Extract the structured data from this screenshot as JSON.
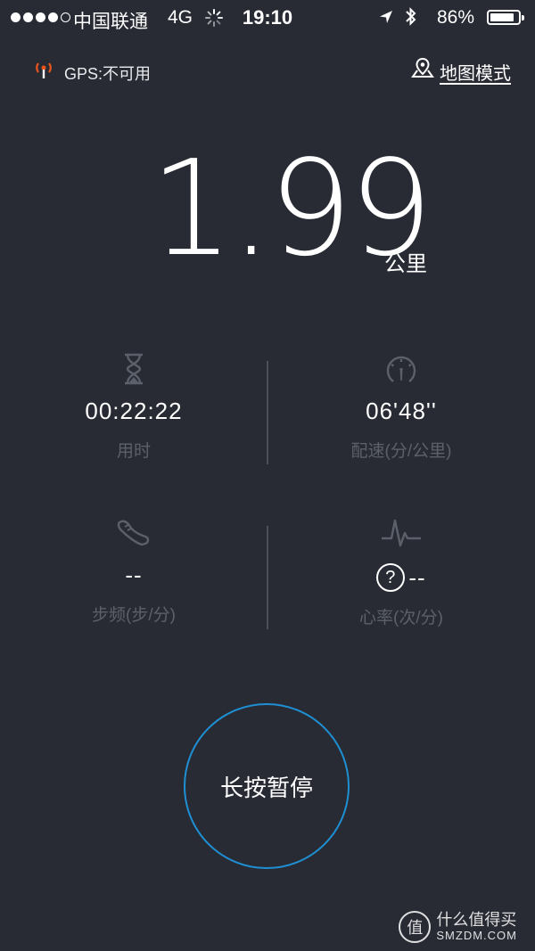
{
  "status_bar": {
    "carrier": "中国联通",
    "network": "4G",
    "time": "19:10",
    "battery": "86%",
    "battery_level": 0.86,
    "signal_bars": 4
  },
  "header": {
    "gps_status": "GPS:不可用",
    "map_mode": "地图模式"
  },
  "distance": {
    "value": "1.99",
    "unit": "公里"
  },
  "stats": {
    "duration": {
      "value": "00:22:22",
      "label": "用时",
      "icon": "hourglass-icon"
    },
    "pace": {
      "value": "06'48''",
      "label": "配速(分/公里)",
      "icon": "speedometer-icon"
    },
    "cadence": {
      "value": "--",
      "label": "步频(步/分)",
      "icon": "shoe-icon"
    },
    "heart_rate": {
      "value": "--",
      "help": "?",
      "label": "心率(次/分)",
      "icon": "heartbeat-icon"
    }
  },
  "pause_button": {
    "label": "长按暂停"
  },
  "watermark": {
    "logo_char": "值",
    "cn": "什么值得买",
    "en": "SMZDM.COM"
  },
  "colors": {
    "background": "#282b34",
    "accent_ring": "#1f8fd3",
    "gps_icon": "#e8541c",
    "dim_text": "#5c606a"
  }
}
